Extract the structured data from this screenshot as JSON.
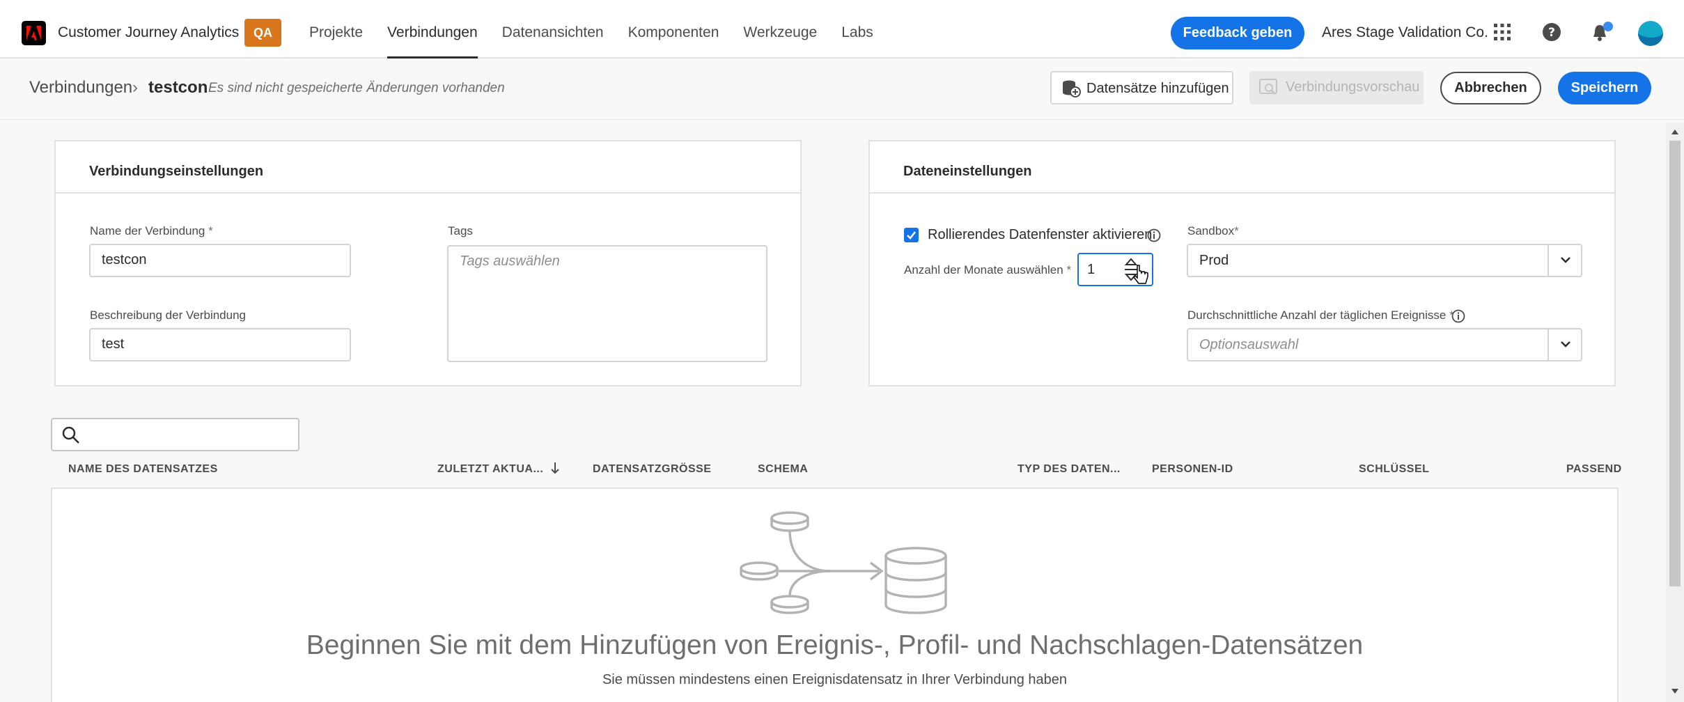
{
  "app": {
    "name": "Customer Journey Analytics",
    "env_badge": "QA",
    "nav": [
      "Projekte",
      "Verbindungen",
      "Datenansichten",
      "Komponenten",
      "Werkzeuge",
      "Labs"
    ],
    "feedback_label": "Feedback geben",
    "org_name": "Ares Stage Validation Co."
  },
  "breadcrumb": {
    "root": "Verbindungen",
    "separator": "›",
    "current": "testcon",
    "unsaved_note": "Es sind nicht gespeicherte Änderungen vorhanden"
  },
  "actions": {
    "add_datasets": "Datensätze hinzufügen",
    "preview": "Verbindungsvorschau",
    "cancel": "Abbrechen",
    "save": "Speichern"
  },
  "connection_settings": {
    "title": "Verbindungseinstellungen",
    "name_label": "Name der Verbindung",
    "name_value": "testcon",
    "description_label": "Beschreibung der Verbindung",
    "description_value": "test",
    "tags_label": "Tags",
    "tags_placeholder": "Tags auswählen",
    "required_mark": "*"
  },
  "data_settings": {
    "title": "Dateneinstellungen",
    "rolling_window_label": "Rollierendes Datenfenster aktivieren",
    "rolling_window_checked": true,
    "months_label": "Anzahl der Monate auswählen",
    "months_value": "1",
    "sandbox_label": "Sandbox",
    "sandbox_value": "Prod",
    "daily_events_label": "Durchschnittliche Anzahl der täglichen Ereignisse",
    "daily_events_placeholder": "Optionsauswahl",
    "required_mark": "*"
  },
  "dataset_table": {
    "columns": [
      "NAME DES DATENSATZES",
      "ZULETZT AKTUA...",
      "DATENSATZGRÖSSE",
      "SCHEMA",
      "TYP DES DATEN...",
      "PERSONEN-ID",
      "SCHLÜSSEL",
      "PASSEND"
    ],
    "sorted_column": "ZULETZT AKTUA...",
    "sort_direction": "descending",
    "empty_title": "Beginnen Sie mit dem Hinzufügen von Ereignis-, Profil- und Nachschlagen-Datensätzen",
    "empty_subtitle": "Sie müssen mindestens einen Ereignisdatensatz in Ihrer Verbindung haben"
  },
  "colors": {
    "accent": "#1473e6",
    "qa_badge": "#d9761c",
    "notification_dot": "#378ef0"
  },
  "icons": [
    "adobe-logo-icon",
    "apps-grid-icon",
    "help-icon",
    "bell-icon",
    "avatar",
    "dataset-add-icon",
    "preview-icon",
    "info-icon",
    "chevron-down-icon",
    "stepper-arrows-icon",
    "search-icon",
    "sort-down-icon",
    "datasets-illustration-icon",
    "checkmark-icon",
    "cursor-icon"
  ]
}
